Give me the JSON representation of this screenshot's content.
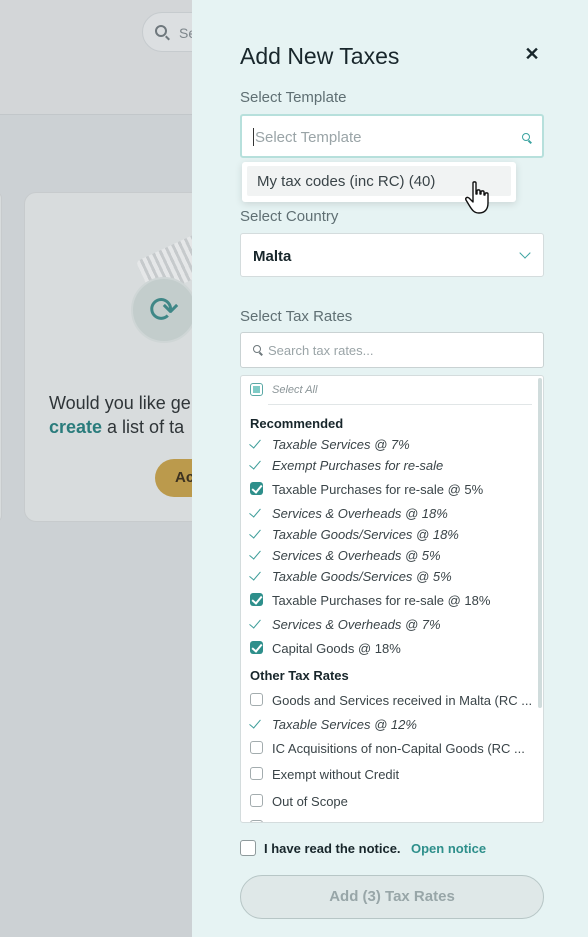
{
  "background": {
    "search_placeholder": "Se",
    "card_text_line1": "Would you like ge",
    "card_text_link": "create",
    "card_text_line2": " a list of ta",
    "card_button": "Ac"
  },
  "drawer": {
    "title": "Add New Taxes",
    "template": {
      "label": "Select Template",
      "placeholder": "Select Template",
      "dropdown_option": "My tax codes (inc RC) (40)"
    },
    "country": {
      "label": "Select Country",
      "value": "Malta"
    },
    "tax_rates": {
      "label": "Select Tax Rates",
      "search_placeholder": "Search tax rates...",
      "select_all": "Select All",
      "recommended_heading": "Recommended",
      "recommended": [
        {
          "label": "Taxable Services @ 7%",
          "state": "tick"
        },
        {
          "label": "Exempt Purchases for re-sale",
          "state": "tick"
        },
        {
          "label": "Taxable Purchases for re-sale @ 5%",
          "state": "checked"
        },
        {
          "label": "Services & Overheads @ 18%",
          "state": "tick"
        },
        {
          "label": "Taxable Goods/Services @ 18%",
          "state": "tick"
        },
        {
          "label": "Services & Overheads @ 5%",
          "state": "tick"
        },
        {
          "label": "Taxable Goods/Services @ 5%",
          "state": "tick"
        },
        {
          "label": "Taxable Purchases for re-sale @ 18%",
          "state": "checked"
        },
        {
          "label": "Services & Overheads @ 7%",
          "state": "tick"
        },
        {
          "label": "Capital Goods @ 18%",
          "state": "checked"
        }
      ],
      "other_heading": "Other Tax Rates",
      "other": [
        {
          "label": "Goods and Services received in Malta (RC ...",
          "state": "unchecked"
        },
        {
          "label": "Taxable Services @ 12%",
          "state": "tick"
        },
        {
          "label": "IC Acquisitions of non-Capital Goods (RC ...",
          "state": "unchecked"
        },
        {
          "label": "Exempt without Credit",
          "state": "unchecked"
        },
        {
          "label": "Out of Scope",
          "state": "unchecked"
        }
      ]
    },
    "notice": {
      "label": "I have read the notice.",
      "link": "Open notice"
    },
    "submit_label": "Add (3) Tax Rates"
  },
  "colors": {
    "accent": "#2e8f8b",
    "drawer_bg": "#e6f3f3",
    "overlay_bg": "#ccd1d4"
  }
}
